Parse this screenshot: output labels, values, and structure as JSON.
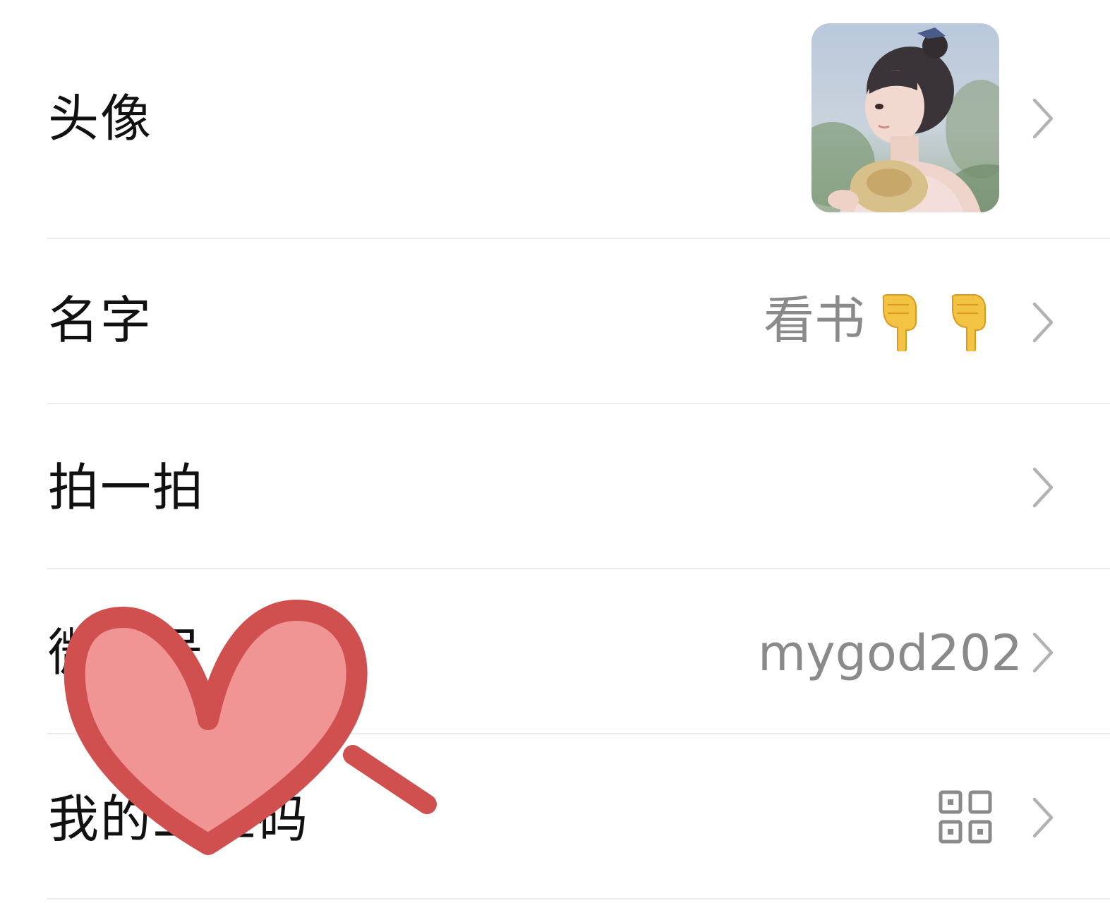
{
  "rows": {
    "avatar": {
      "label": "头像"
    },
    "name": {
      "label": "名字",
      "value": "看书"
    },
    "pat": {
      "label": "拍一拍"
    },
    "wechat_id": {
      "label": "微信号",
      "value": "mygod202"
    },
    "qrcode": {
      "label": "我的二维码"
    }
  },
  "icons": {
    "chevron": "chevron-right-icon",
    "emoji": "pointing-down-emoji",
    "qr": "qr-code-icon"
  },
  "colors": {
    "heart_stroke": "#d05050",
    "heart_fill": "#f09494",
    "label": "#111111",
    "value": "#8a8a8a",
    "chevron": "#b2b2b2",
    "divider": "#ececec"
  }
}
